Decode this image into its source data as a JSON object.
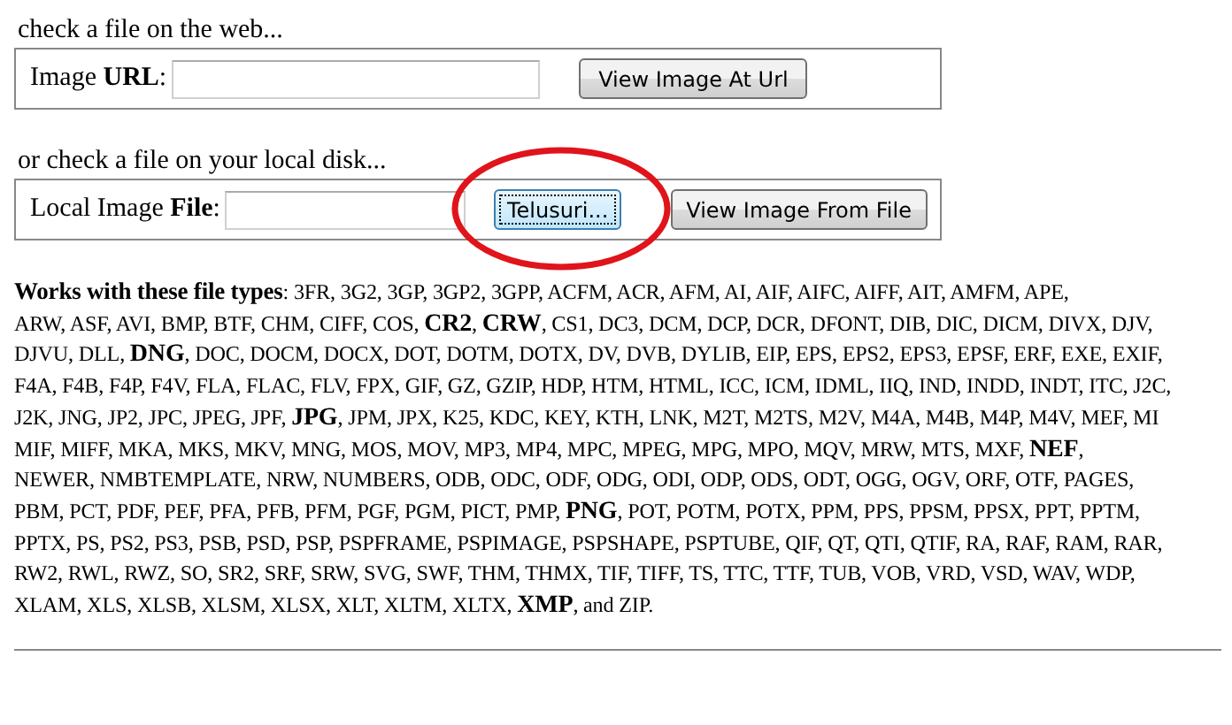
{
  "web_section": {
    "heading": "check a file on the web...",
    "label": "Image **URL**:",
    "button": "View Image At Url"
  },
  "local_section": {
    "heading": "or check a file on your local disk...",
    "label": "Local Image **File**:",
    "browse_button": {
      "label": "Telusuri...",
      "focused": true
    },
    "button": "View Image From File"
  },
  "file_types": {
    "lines": [
      "**Works with these file types**: 3FR, 3G2, 3GP, 3GP2, 3GPP, ACFM, ACR, AFM, AI, AIF, AIFC, AIFF, AIT, AMFM, APE,",
      "ARW, ASF, AVI, BMP, BTF, CHM, CIFF, COS, **CR2**, **CRW**, CS1, DC3, DCM, DCP, DCR, DFONT, DIB, DIC, DICM, DIVX, DJV,",
      "DJVU, DLL, **DNG**, DOC, DOCM, DOCX, DOT, DOTM, DOTX, DV, DVB, DYLIB, EIP, EPS, EPS2, EPS3, EPSF, ERF, EXE, EXIF,",
      "F4A, F4B, F4P, F4V, FLA, FLAC, FLV, FPX, GIF, GZ, GZIP, HDP, HTM, HTML, ICC, ICM, IDML, IIQ, IND, INDD, INDT, ITC, J2C,",
      "J2K, JNG, JP2, JPC, JPEG, JPF, **JPG**, JPM, JPX, K25, KDC, KEY, KTH, LNK, M2T, M2TS, M2V, M4A, M4B, M4P, M4V, MEF, MI",
      "MIF, MIFF, MKA, MKS, MKV, MNG, MOS, MOV, MP3, MP4, MPC, MPEG, MPG, MPO, MQV, MRW, MTS, MXF, **NEF**,",
      "NEWER, NMBTEMPLATE, NRW, NUMBERS, ODB, ODC, ODF, ODG, ODI, ODP, ODS, ODT, OGG, OGV, ORF, OTF, PAGES,",
      "PBM, PCT, PDF, PEF, PFA, PFB, PFM, PGF, PGM, PICT, PMP, **PNG**, POT, POTM, POTX, PPM, PPS, PPSM, PPSX, PPT, PPTM,",
      "PPTX, PS, PS2, PS3, PSB, PSD, PSP, PSPFRAME, PSPIMAGE, PSPSHAPE, PSPTUBE, QIF, QT, QTI, QTIF, RA, RAF, RAM, RAR,",
      "RW2, RWL, RWZ, SO, SR2, SRF, SRW, SVG, SWF, THM, THMX, TIF, TIFF, TS, TTC, TTF, TUB, VOB, VRD, VSD, WAV, WDP,",
      "XLAM, XLS, XLSB, XLSM, XLSX, XLT, XLTM, XLTX, **XMP**, and ZIP."
    ]
  }
}
